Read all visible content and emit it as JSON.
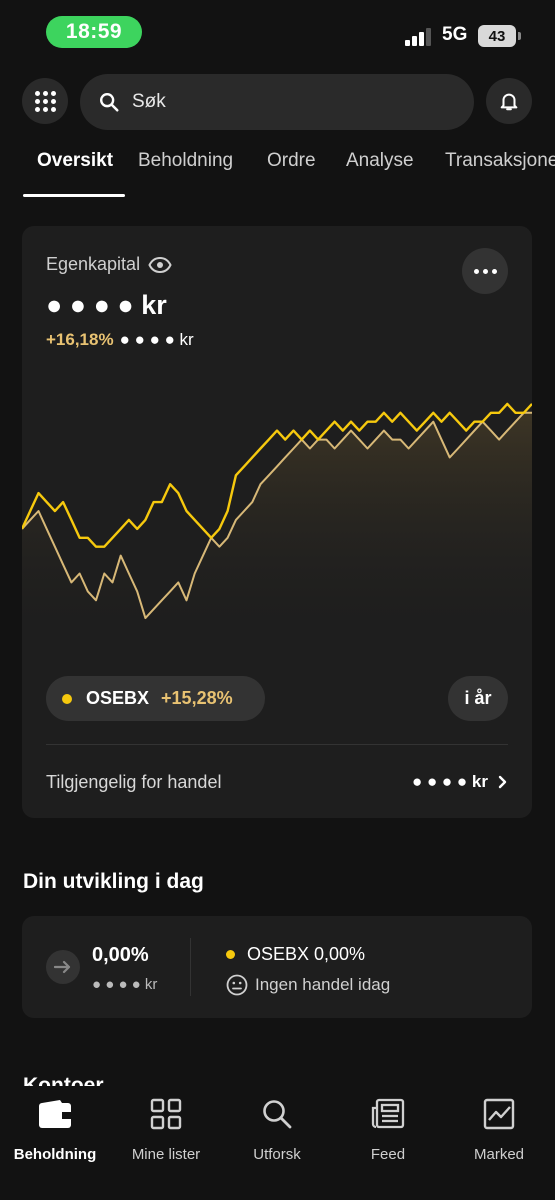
{
  "status": {
    "time": "18:59",
    "network": "5G",
    "battery": "43"
  },
  "search": {
    "placeholder": "Søk"
  },
  "tabs": [
    {
      "label": "Oversikt",
      "active": true
    },
    {
      "label": "Beholdning"
    },
    {
      "label": "Ordre"
    },
    {
      "label": "Analyse"
    },
    {
      "label": "Transaksjoner"
    }
  ],
  "equity": {
    "label": "Egenkapital",
    "masked_value": "● ● ● ● kr",
    "gain_pct": "+16,18%",
    "gain_amount": "● ● ● ● kr"
  },
  "benchmark": {
    "name": "OSEBX",
    "change": "+15,28%",
    "period": "i år"
  },
  "available": {
    "label": "Tilgjengelig for handel",
    "value": "● ● ● ● kr"
  },
  "today": {
    "title": "Din utvikling i dag",
    "pct": "0,00%",
    "amount": "● ● ● ● kr",
    "benchmark_line": "OSEBX 0,00%",
    "no_trade": "Ingen handel idag"
  },
  "accounts_peek": "Kontoer",
  "nav": [
    {
      "label": "Beholdning",
      "icon": "wallet-icon",
      "active": true
    },
    {
      "label": "Mine lister",
      "icon": "grid-icon"
    },
    {
      "label": "Utforsk",
      "icon": "search-icon"
    },
    {
      "label": "Feed",
      "icon": "newspaper-icon"
    },
    {
      "label": "Marked",
      "icon": "chart-icon"
    }
  ],
  "colors": {
    "accent_gain": "#e8c272",
    "benchmark_dot": "#f6c90e",
    "portfolio_line": "#f6c90e",
    "benchmark_line": "#d7b877",
    "status_pill": "#3dd45e"
  },
  "chart_data": {
    "type": "line",
    "y_percent_range": [
      -10,
      18
    ],
    "series": [
      {
        "name": "",
        "values": [
          2,
          4,
          6,
          5,
          4,
          5,
          3,
          1,
          1,
          0,
          0,
          1,
          2,
          3,
          2,
          3,
          5,
          5,
          7,
          6,
          4,
          3,
          2,
          1,
          2,
          4,
          8,
          9,
          10,
          11,
          12,
          13,
          12,
          13,
          12,
          13,
          12,
          13,
          14,
          13,
          14,
          13,
          14,
          14,
          15,
          14,
          15,
          14,
          13,
          14,
          15,
          14,
          15,
          14,
          13,
          14,
          14,
          15,
          15,
          16,
          15,
          15,
          16
        ]
      },
      {
        "name": "OSEBX",
        "values": [
          2,
          3,
          4,
          2,
          0,
          -2,
          -4,
          -3,
          -5,
          -6,
          -3,
          -4,
          -1,
          -3,
          -5,
          -8,
          -7,
          -6,
          -5,
          -4,
          -6,
          -3,
          -1,
          1,
          0,
          1,
          3,
          4,
          5,
          7,
          8,
          9,
          10,
          11,
          12,
          11,
          12,
          12,
          11,
          12,
          13,
          12,
          11,
          12,
          13,
          12,
          12,
          11,
          12,
          13,
          14,
          12,
          10,
          11,
          12,
          13,
          14,
          13,
          12,
          13,
          14,
          15,
          15
        ]
      }
    ]
  }
}
